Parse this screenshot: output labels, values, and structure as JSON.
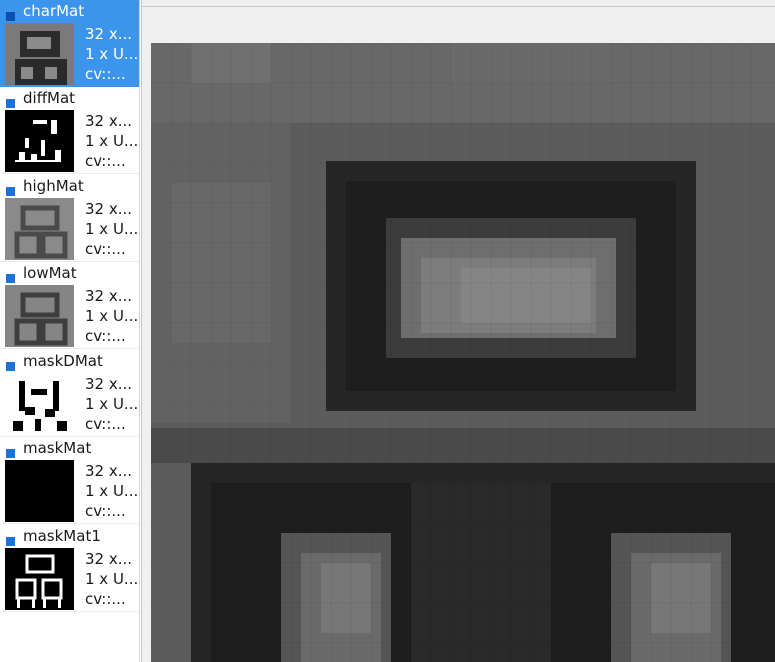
{
  "variables": [
    {
      "name": "charMat",
      "line1": "32 x...",
      "line2": "1 x U...",
      "line3": "cv::...",
      "selected": true,
      "thumb": "char"
    },
    {
      "name": "diffMat",
      "line1": "32 x...",
      "line2": "1 x U...",
      "line3": "cv::...",
      "selected": false,
      "thumb": "diff"
    },
    {
      "name": "highMat",
      "line1": "32 x...",
      "line2": "1 x U...",
      "line3": "cv::...",
      "selected": false,
      "thumb": "high"
    },
    {
      "name": "lowMat",
      "line1": "32 x...",
      "line2": "1 x U...",
      "line3": "cv::...",
      "selected": false,
      "thumb": "low"
    },
    {
      "name": "maskDMat",
      "line1": "32 x...",
      "line2": "1 x U...",
      "line3": "cv::...",
      "selected": false,
      "thumb": "maskd"
    },
    {
      "name": "maskMat",
      "line1": "32 x...",
      "line2": "1 x U...",
      "line3": "cv::...",
      "selected": false,
      "thumb": "mask"
    },
    {
      "name": "maskMat1",
      "line1": "32 x...",
      "line2": "1 x U...",
      "line3": "cv::...",
      "selected": false,
      "thumb": "mask1"
    }
  ],
  "colors": {
    "selection": "#3c95ec",
    "marker": "#1a74d8",
    "viewer_bg": "#f0f0f0"
  }
}
